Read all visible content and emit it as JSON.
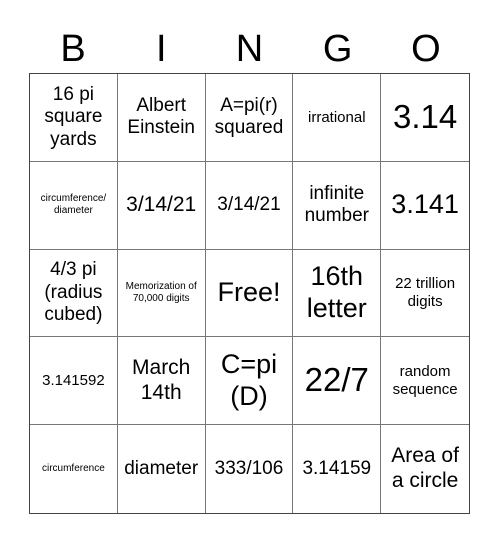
{
  "header": {
    "letters": [
      "B",
      "I",
      "N",
      "G",
      "O"
    ]
  },
  "cells": [
    {
      "text": "16 pi square yards",
      "size": "s-lg"
    },
    {
      "text": "Albert Einstein",
      "size": "s-lg"
    },
    {
      "text": "A=pi(r) squared",
      "size": "s-lg"
    },
    {
      "text": "irrational",
      "size": "s-md"
    },
    {
      "text": "3.14",
      "size": "s-huge"
    },
    {
      "text": "circumference/ diameter",
      "size": "s-xs"
    },
    {
      "text": "3/14/21",
      "size": "s-xl"
    },
    {
      "text": "3/14/21",
      "size": "s-lg"
    },
    {
      "text": "infinite number",
      "size": "s-lg"
    },
    {
      "text": "3.141",
      "size": "s-xxl"
    },
    {
      "text": "4/3 pi (radius cubed)",
      "size": "s-lg"
    },
    {
      "text": "Memorization of 70,000 digits",
      "size": "s-xs"
    },
    {
      "text": "Free!",
      "size": "s-xxl"
    },
    {
      "text": "16th letter",
      "size": "s-xxl"
    },
    {
      "text": "22 trillion digits",
      "size": "s-md"
    },
    {
      "text": "3.141592",
      "size": "s-md"
    },
    {
      "text": "March 14th",
      "size": "s-xl"
    },
    {
      "text": "C=pi (D)",
      "size": "s-xxl"
    },
    {
      "text": "22/7",
      "size": "s-huge"
    },
    {
      "text": "random sequence",
      "size": "s-md"
    },
    {
      "text": "circumference",
      "size": "s-xs"
    },
    {
      "text": "diameter",
      "size": "s-lg"
    },
    {
      "text": "333/106",
      "size": "s-lg"
    },
    {
      "text": "3.14159",
      "size": "s-lg"
    },
    {
      "text": "Area of a circle",
      "size": "s-xl"
    }
  ]
}
